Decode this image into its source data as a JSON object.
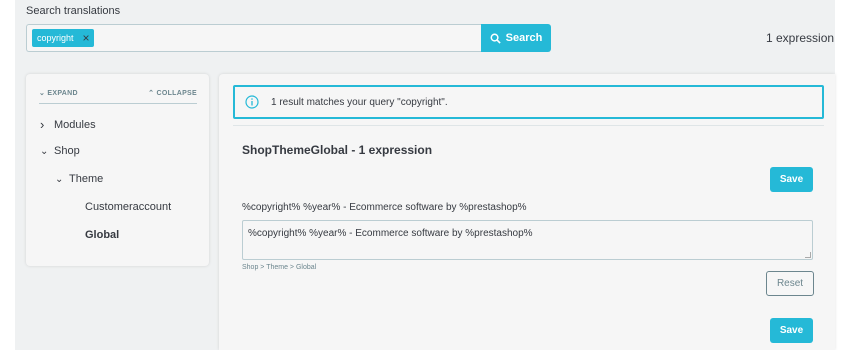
{
  "search": {
    "label": "Search translations",
    "tag": "copyright",
    "tag_remove": "×",
    "button_label": "Search",
    "results_count": "1 expression"
  },
  "tree": {
    "expand_label": "EXPAND",
    "collapse_label": "COLLAPSE",
    "nodes": [
      {
        "label": "Modules",
        "chevron": "›"
      },
      {
        "label": "Shop",
        "chevron": "⌄"
      },
      {
        "label": "Theme",
        "chevron": "⌄"
      },
      {
        "label": "Customeraccount"
      },
      {
        "label": "Global"
      }
    ]
  },
  "main": {
    "alert_text": "1 result matches your query \"copyright\".",
    "domain_title": "ShopThemeGlobal - 1 expression",
    "save_label": "Save",
    "source_text": "%copyright% %year% - Ecommerce software by %prestashop%",
    "translation_value": "%copyright% %year% - Ecommerce software by %prestashop%",
    "breadcrumb": "Shop > Theme > Global",
    "reset_label": "Reset"
  },
  "colors": {
    "accent": "#25b9d7",
    "text": "#363a41",
    "muted": "#6c868e",
    "background": "#eff1f2"
  }
}
